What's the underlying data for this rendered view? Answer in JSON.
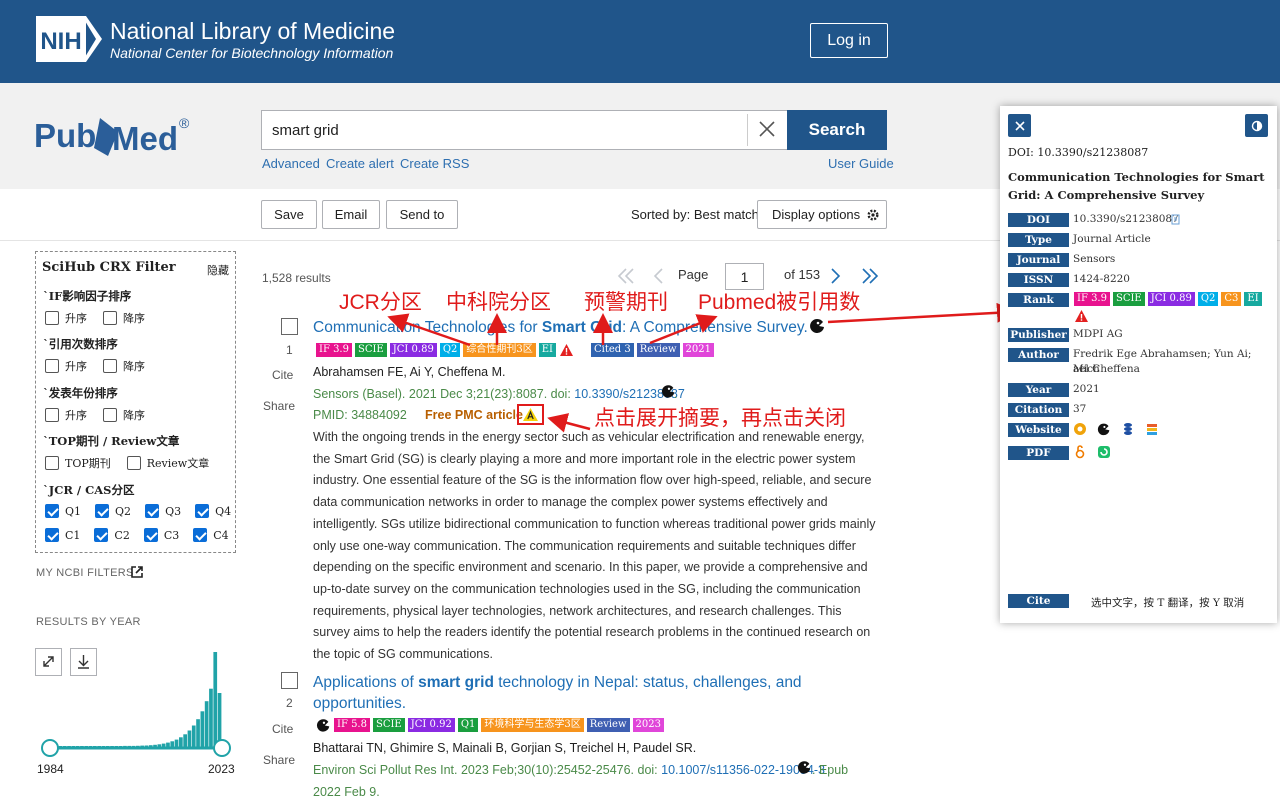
{
  "header": {
    "org_title": "National Library of Medicine",
    "org_subtitle": "National Center for Biotechnology Information",
    "login_label": "Log in",
    "logo_text": "NIH"
  },
  "search": {
    "logo_text_1": "Pub",
    "logo_text_2": "Med",
    "logo_reg": "®",
    "query": "smart grid",
    "button_label": "Search",
    "links": [
      "Advanced",
      "Create alert",
      "Create RSS"
    ],
    "user_guide": "User Guide"
  },
  "toolbar": {
    "save": "Save",
    "email": "Email",
    "send_to": "Send to",
    "sorted_by": "Sorted by: Best match",
    "display_options": "Display options"
  },
  "filter": {
    "title": "SciHub CRX Filter",
    "hide": "隐藏",
    "sections": [
      {
        "label": "`IF影响因子排序",
        "options": [
          "升序",
          "降序"
        ]
      },
      {
        "label": "`引用次数排序",
        "options": [
          "升序",
          "降序"
        ]
      },
      {
        "label": "`发表年份排序",
        "options": [
          "升序",
          "降序"
        ]
      },
      {
        "label": "`TOP期刊 / Review文章",
        "options": [
          "TOP期刊",
          "Review文章"
        ]
      },
      {
        "label": "`JCR / CAS分区",
        "options": [
          "Q1",
          "Q2",
          "Q3",
          "Q4",
          "C1",
          "C2",
          "C3",
          "C4"
        ]
      }
    ]
  },
  "sidebar": {
    "my_ncbi_filters": "MY NCBI FILTERS",
    "results_by_year": "RESULTS BY YEAR",
    "year_start": "1984",
    "year_end": "2023"
  },
  "results": {
    "count": "1,528 results",
    "page_label": "Page",
    "page": "1",
    "of_pages": "of 153"
  },
  "articles": [
    {
      "num": "1",
      "title_a": "Communication Technologies for ",
      "title_b": "Smart Grid",
      "title_c": ": A Comprehensive Survey.",
      "badges": [
        "IF 3.9",
        "SCIE",
        "JCI 0.89",
        "Q2",
        "综合性期刊3区",
        "EI",
        "Cited 3",
        "Review",
        "2021"
      ],
      "authors": "Abrahamsen FE, Ai Y, Cheffena M.",
      "citation": "Sensors (Basel). 2021 Dec 3;21(23):8087. doi: ",
      "doi": "10.3390/s21238087",
      "pmid": "PMID: 34884092",
      "free_pmc": "Free PMC article",
      "abstract": "With the ongoing trends in the energy sector such as vehicular electrification and renewable energy, the Smart Grid (SG) is clearly playing a more and more important role in the electric power system industry. One essential feature of the SG is the information flow over high-speed, reliable, and secure data communication networks in order to manage the complex power systems effectively and intelligently. SGs utilize bidirectional communication to function whereas traditional power grids mainly only use one-way communication. The communication requirements and suitable techniques differ depending on the specific environment and scenario. In this paper, we provide a comprehensive and up-to-date survey on the communication technologies used in the SG, including the communication requirements, physical layer technologies, network architectures, and research challenges. This survey aims to help the readers identify the potential research problems in the continued research on the topic of SG communications."
    },
    {
      "num": "2",
      "title_a": "Applications of ",
      "title_b": "smart grid",
      "title_c": " technology in Nepal: status, challenges, and",
      "title_d": "opportunities.",
      "badges": [
        "IF 5.8",
        "SCIE",
        "JCI 0.92",
        "Q1",
        "环境科学与生态学3区",
        "Review",
        "2023"
      ],
      "authors": "Bhattarai TN, Ghimire S, Mainali B, Gorjian S, Treichel H, Paudel SR.",
      "citation": "Environ Sci Pollut Res Int. 2023 Feb;30(10):25452-25476. doi: ",
      "doi": "10.1007/s11356-022-19084-3",
      "epub": ". Epub",
      "epub2": "2022 Feb 9."
    }
  ],
  "actions": {
    "cite": "Cite",
    "share": "Share"
  },
  "annotations": {
    "jcr": "JCR分区",
    "cas": "中科院分区",
    "warning": "预警期刊",
    "cited": "Pubmed被引用数",
    "expand": "点击展开摘要，再点击关闭"
  },
  "panel": {
    "doi_header": "DOI: 10.3390/s21238087",
    "title": "Communication Technologies for Smart Grid: A Comprehensive Survey",
    "rows": [
      {
        "label": "DOI",
        "value": "10.3390/s21238087"
      },
      {
        "label": "Type",
        "value": "Journal Article"
      },
      {
        "label": "Journal",
        "value": "Sensors"
      },
      {
        "label": "ISSN",
        "value": "1424-8220"
      },
      {
        "label": "Rank",
        "value": ""
      },
      {
        "label": "Publisher",
        "value": "MDPI AG"
      },
      {
        "label": "Author",
        "value": "Fredrik Ege Abrahamsen; Yun Ai; Mich"
      },
      {
        "label": "Year",
        "value": "2021"
      },
      {
        "label": "Citation",
        "value": "37"
      },
      {
        "label": "Website",
        "value": ""
      },
      {
        "label": "PDF",
        "value": ""
      }
    ],
    "author_cont": "ael Cheffena",
    "rank_badges": [
      "IF 3.9",
      "SCIE",
      "JCI 0.89",
      "Q2",
      "C3",
      "EI"
    ],
    "cite_label": "Cite",
    "footer_hint": "选中文字，按 T 翻译，按 Y 取消"
  },
  "colors": {
    "nih_blue": "#20558a",
    "link_blue": "#1f6fb5",
    "annotation_red": "#e01b1b",
    "badge_if": "#e8138e",
    "badge_scie": "#1a9e3f",
    "badge_jci": "#8a2be2",
    "badge_q": "#00aee8",
    "badge_cas": "#f7941d",
    "badge_ei": "#16a99f",
    "badge_cited": "#2f63b0",
    "badge_review": "#3f5fb2",
    "badge_year": "#e046d9"
  }
}
